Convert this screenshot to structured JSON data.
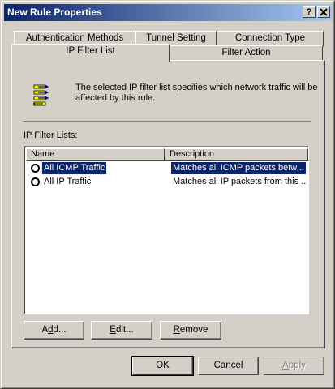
{
  "window": {
    "title": "New Rule Properties",
    "help_label": "?",
    "close_label": "x"
  },
  "tabs": {
    "row1": [
      "Authentication Methods",
      "Tunnel Setting",
      "Connection Type"
    ],
    "row2": [
      "IP Filter List",
      "Filter Action"
    ],
    "active": "IP Filter List"
  },
  "description": "The selected IP filter list specifies which network traffic will be affected by this rule.",
  "filter_lists": {
    "label_prefix": "IP Filter ",
    "label_accel": "L",
    "label_suffix": "ists:",
    "columns": [
      "Name",
      "Description"
    ],
    "rows": [
      {
        "name": "All ICMP Traffic",
        "description": "Matches all ICMP packets betw...",
        "selected": true
      },
      {
        "name": "All IP Traffic",
        "description": "Matches all IP packets from this ...",
        "selected": false
      }
    ]
  },
  "buttons": {
    "add": {
      "pre": "A",
      "accel": "d",
      "post": "d..."
    },
    "edit": {
      "pre": "",
      "accel": "E",
      "post": "dit..."
    },
    "remove": {
      "pre": "",
      "accel": "R",
      "post": "emove"
    },
    "ok": "OK",
    "cancel": "Cancel",
    "apply": {
      "pre": "",
      "accel": "A",
      "post": "pply"
    }
  },
  "colors": {
    "face": "#d4d0c8",
    "title_start": "#0a246a",
    "title_end": "#a6caf0",
    "selection": "#0a246a"
  }
}
